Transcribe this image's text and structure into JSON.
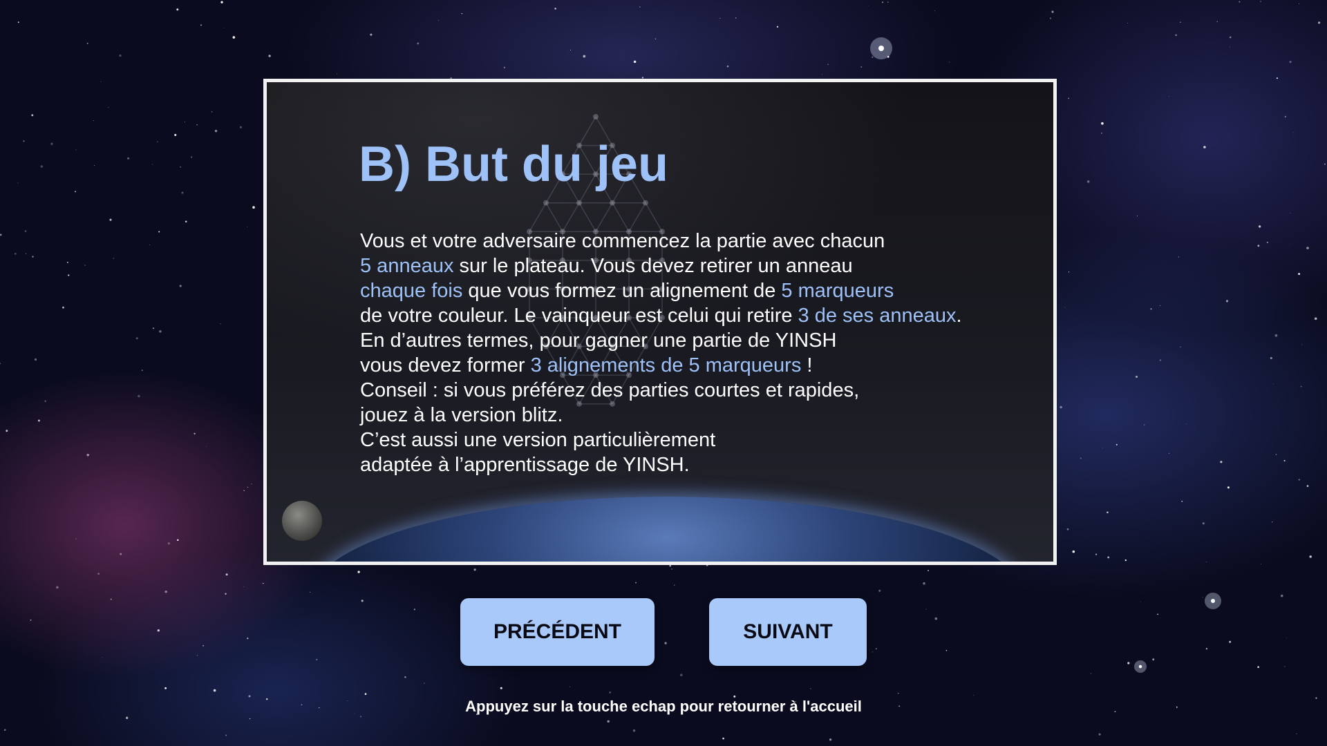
{
  "slide": {
    "title": "B) But du jeu",
    "lines": [
      [
        {
          "t": "Vous et votre adversaire commencez la partie avec chacun",
          "h": false
        }
      ],
      [
        {
          "t": "5 anneaux",
          "h": true
        },
        {
          "t": " sur le plateau. Vous devez retirer un anneau",
          "h": false
        }
      ],
      [
        {
          "t": "chaque fois",
          "h": true
        },
        {
          "t": " que vous formez un alignement de ",
          "h": false
        },
        {
          "t": "5 marqueurs",
          "h": true
        }
      ],
      [
        {
          "t": "de votre couleur. Le vainqueur est celui qui retire ",
          "h": false
        },
        {
          "t": "3 de ses anneaux",
          "h": true
        },
        {
          "t": ".",
          "h": false
        }
      ],
      [
        {
          "t": "En d’autres termes, pour gagner une partie de YINSH",
          "h": false
        }
      ],
      [
        {
          "t": "vous devez former ",
          "h": false
        },
        {
          "t": "3 alignements de 5 marqueurs",
          "h": true
        },
        {
          "t": " !",
          "h": false
        }
      ],
      [
        {
          "t": "Conseil : si vous préférez des parties courtes et rapides,",
          "h": false
        }
      ],
      [
        {
          "t": "jouez à la version blitz.",
          "h": false
        }
      ],
      [
        {
          "t": "C’est aussi une version particulièrement",
          "h": false
        }
      ],
      [
        {
          "t": "adaptée à l’apprentissage de YINSH.",
          "h": false
        }
      ]
    ]
  },
  "buttons": {
    "previous": "PRÉCÉDENT",
    "next": "SUIVANT"
  },
  "hint": "Appuyez sur la touche echap pour retourner à l'accueil",
  "colors": {
    "accent": "#9ec1f7",
    "button_bg": "#a9c9fb",
    "text": "#ffffff",
    "frame": "#f2f2f2"
  }
}
